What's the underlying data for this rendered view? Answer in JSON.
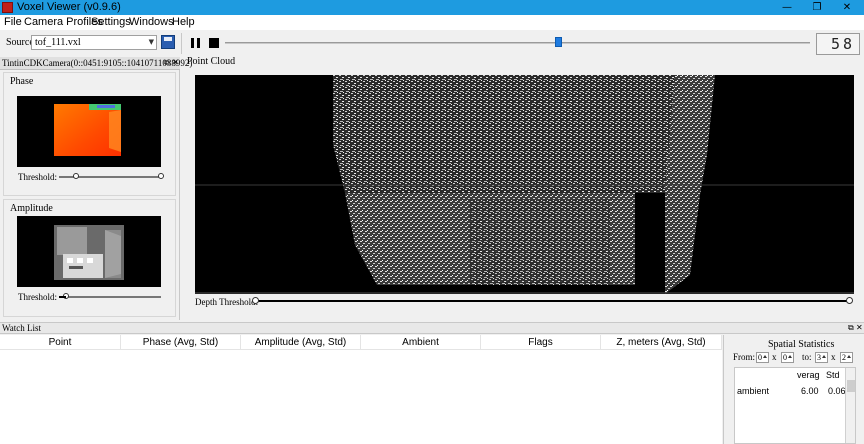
{
  "window": {
    "title": "Voxel Viewer (v0.9.6)",
    "minimize_glyph": "—",
    "restore_glyph": "❐",
    "close_glyph": "✕"
  },
  "menu": {
    "items": [
      "File",
      "Camera Profiles",
      "Settings",
      "Windows",
      "Help"
    ]
  },
  "toolbar": {
    "source_label": "Source:",
    "source_value": "tof_111.vxl",
    "frame_position": 0.57,
    "frame_display": "58"
  },
  "camera_panel": {
    "title": "TintinCDKCamera(0::0451:9105::10410711038992)",
    "phase": {
      "title": "Phase",
      "threshold_label": "Threshold:",
      "threshold_low": 0.17,
      "threshold_high": 1.0
    },
    "amplitude": {
      "title": "Amplitude",
      "threshold_label": "Threshold:",
      "threshold_low": 0.07
    }
  },
  "point_cloud": {
    "title": "Point Cloud",
    "depth_threshold_label": "Depth Threshold:",
    "depth_low": 0.0,
    "depth_high": 1.0
  },
  "watch_list": {
    "title": "Watch List",
    "columns": [
      "Point",
      "Phase (Avg, Std)",
      "Amplitude (Avg, Std)",
      "Ambient",
      "Flags",
      "Z, meters (Avg, Std)"
    ]
  },
  "spatial_statistics": {
    "title": "Spatial Statistics",
    "from_label": "From:",
    "x_label": "x",
    "to_label": "to:",
    "from_x": "0",
    "from_y": "0",
    "to_x": "3",
    "to_y": "2",
    "col_average": "verag",
    "col_std": "Std",
    "rows": [
      {
        "name": "ambient",
        "average": "6.00",
        "std": "0.06"
      }
    ]
  },
  "colors": {
    "titlebar": "#1e9be0",
    "slider_handle": "#1e7be0",
    "phase_image": "#ff5a00"
  }
}
